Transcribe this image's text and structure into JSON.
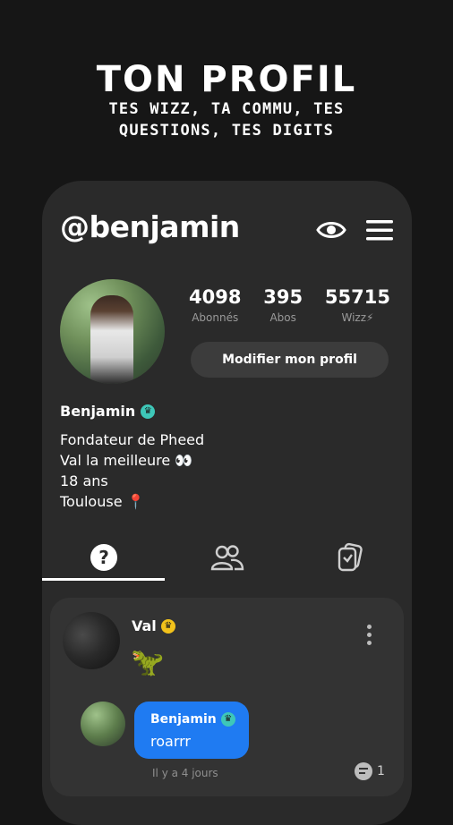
{
  "promo": {
    "title": "TON PROFIL",
    "subtitle": "TES WIZZ, TA COMMU, TES QUESTIONS, TES DIGITS"
  },
  "profile": {
    "username": "@benjamin",
    "stats": [
      {
        "value": "4098",
        "label": "Abonnés"
      },
      {
        "value": "395",
        "label": "Abos"
      },
      {
        "value": "55715",
        "label": "Wizz⚡"
      }
    ],
    "edit_button": "Modifier mon profil",
    "display_name": "Benjamin",
    "bio_lines": [
      "Fondateur de Pheed",
      "Val la meilleure 👀",
      "18 ans",
      "Toulouse 📍"
    ]
  },
  "tabs": [
    {
      "name": "questions",
      "icon": "question-icon",
      "active": true
    },
    {
      "name": "community",
      "icon": "users-icon",
      "active": false
    },
    {
      "name": "digits",
      "icon": "cards-icon",
      "active": false
    }
  ],
  "post": {
    "author": "Val",
    "author_badge_color": "#f2c21b",
    "emoji": "🦖",
    "reply": {
      "author": "Benjamin",
      "author_badge_color": "#3ec7b8",
      "text": "roarrr"
    },
    "time": "Il y a 4 jours",
    "reply_count": "1"
  },
  "colors": {
    "background": "#161616",
    "panel": "#2a2a2a",
    "card": "#333333",
    "accent_blue": "#1f7bf2"
  }
}
